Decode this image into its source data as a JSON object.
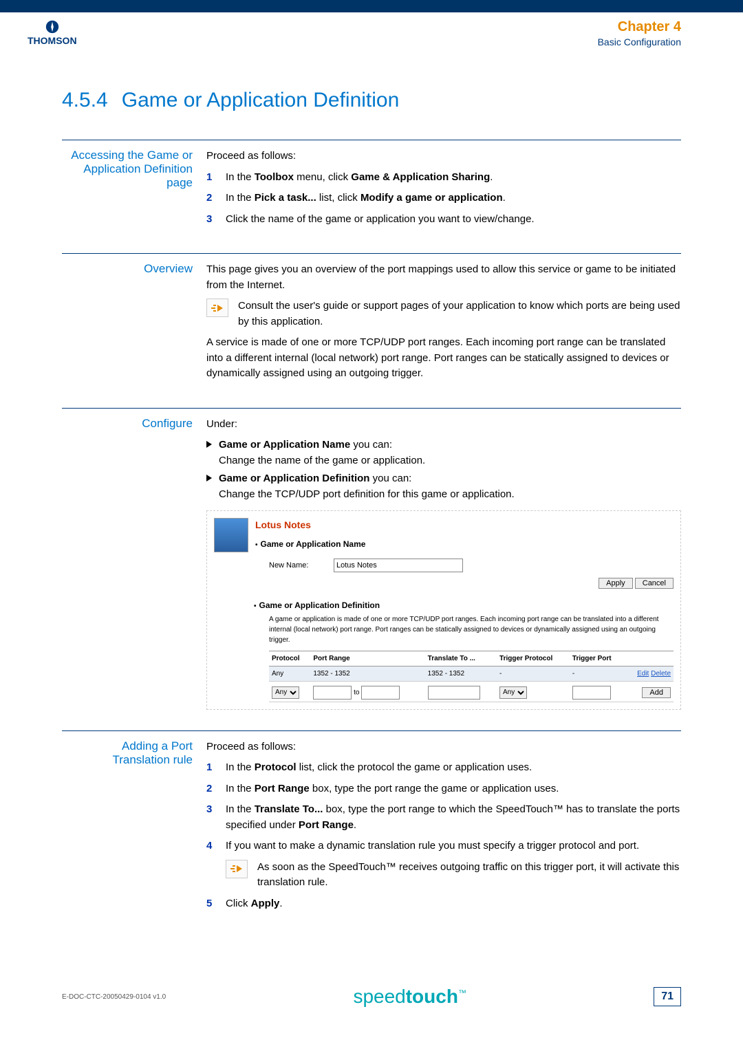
{
  "header": {
    "brand": "THOMSON",
    "chapter_label": "Chapter 4",
    "chapter_sub": "Basic Configuration"
  },
  "section": {
    "number": "4.5.4",
    "title": "Game or Application Definition"
  },
  "blocks": {
    "accessing": {
      "label": "Accessing the Game or Application Definition page",
      "intro": "Proceed as follows:",
      "steps": [
        {
          "n": "1",
          "pre": "In the ",
          "b1": "Toolbox",
          "mid": " menu, click ",
          "b2": "Game & Application Sharing",
          "end": "."
        },
        {
          "n": "2",
          "pre": "In the ",
          "b1": "Pick a task...",
          "mid": " list, click ",
          "b2": "Modify a game or application",
          "end": "."
        },
        {
          "n": "3",
          "pre": "Click the name of the game or application you want to view/change.",
          "b1": "",
          "mid": "",
          "b2": "",
          "end": ""
        }
      ]
    },
    "overview": {
      "label": "Overview",
      "p1": "This page gives you an overview of the port mappings used to allow this service or game to be initiated from the Internet.",
      "note": "Consult the user's guide or support pages of your application to know which ports are being used by this application.",
      "p2": "A service is made of one or more TCP/UDP port ranges. Each incoming port range can be translated into a different internal (local network) port range. Port ranges can be statically assigned to devices or dynamically assigned using an outgoing trigger."
    },
    "configure": {
      "label": "Configure",
      "intro": "Under:",
      "items": [
        {
          "b": "Game or Application Name",
          "tail": " you can:",
          "desc": "Change the name of the game or application."
        },
        {
          "b": "Game or Application Definition",
          "tail": " you can:",
          "desc": "Change the TCP/UDP port definition for this game or application."
        }
      ],
      "screenshot": {
        "title": "Lotus Notes",
        "sub1": "Game or Application Name",
        "field_label": "New Name:",
        "field_value": "Lotus Notes",
        "apply": "Apply",
        "cancel": "Cancel",
        "sub2": "Game or Application Definition",
        "desc": "A game or application is made of one or more TCP/UDP port ranges. Each incoming port range can be translated into a different internal (local network) port range. Port ranges can be statically assigned to devices or dynamically assigned using an outgoing trigger.",
        "headers": [
          "Protocol",
          "Port Range",
          "Translate To ...",
          "Trigger Protocol",
          "Trigger Port",
          ""
        ],
        "row": {
          "protocol": "Any",
          "range": "1352 - 1352",
          "translate": "1352 - 1352",
          "tproto": "-",
          "tport": "-",
          "edit": "Edit",
          "del": "Delete"
        },
        "ctrl": {
          "proto": "Any",
          "to": "to",
          "tproto": "Any",
          "add": "Add"
        }
      }
    },
    "adding": {
      "label": "Adding a Port Translation rule",
      "intro": "Proceed as follows:",
      "steps": [
        {
          "n": "1",
          "html": "In the <b>Protocol</b> list, click the protocol the game or application uses."
        },
        {
          "n": "2",
          "html": "In the <b>Port Range</b> box, type the port range the game or application uses."
        },
        {
          "n": "3",
          "html": "In the <b>Translate To...</b> box, type the port range to which the SpeedTouch™ has to translate the ports specified under <b>Port Range</b>."
        },
        {
          "n": "4",
          "html": "If you want to make a dynamic translation rule you must specify a trigger protocol and port."
        }
      ],
      "note": "As soon as the SpeedTouch™ receives outgoing traffic on this trigger port, it will activate this translation rule.",
      "step5": {
        "n": "5",
        "pre": "Click ",
        "b": "Apply",
        "end": "."
      }
    }
  },
  "footer": {
    "doc_id": "E-DOC-CTC-20050429-0104 v1.0",
    "brand_light": "speed",
    "brand_bold": "touch",
    "tm": "™",
    "page": "71"
  }
}
